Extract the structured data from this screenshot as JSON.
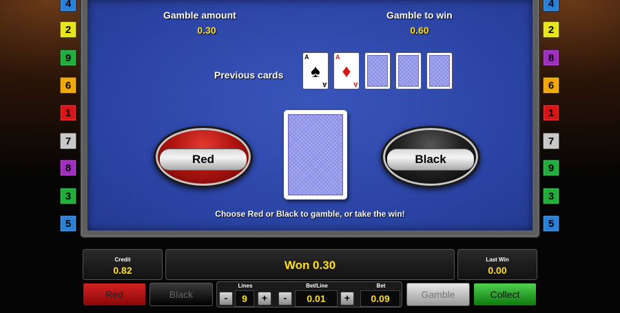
{
  "left_badges": [
    {
      "label": "4",
      "color": "#2a7fd6",
      "text_color": "#000"
    },
    {
      "label": "2",
      "color": "#e6e61a",
      "text_color": "#000"
    },
    {
      "label": "9",
      "color": "#1fae3a",
      "text_color": "#000"
    },
    {
      "label": "6",
      "color": "#f0a800",
      "text_color": "#000"
    },
    {
      "label": "1",
      "color": "#d81414",
      "text_color": "#000"
    },
    {
      "label": "7",
      "color": "#c8c8c8",
      "text_color": "#000"
    },
    {
      "label": "8",
      "color": "#a02cc0",
      "text_color": "#000"
    },
    {
      "label": "3",
      "color": "#1fae3a",
      "text_color": "#000"
    },
    {
      "label": "5",
      "color": "#2a7fd6",
      "text_color": "#000"
    }
  ],
  "right_badges": [
    {
      "label": "4",
      "color": "#2a7fd6",
      "text_color": "#000"
    },
    {
      "label": "2",
      "color": "#e6e61a",
      "text_color": "#000"
    },
    {
      "label": "8",
      "color": "#a02cc0",
      "text_color": "#000"
    },
    {
      "label": "6",
      "color": "#f0a800",
      "text_color": "#000"
    },
    {
      "label": "1",
      "color": "#d81414",
      "text_color": "#000"
    },
    {
      "label": "7",
      "color": "#c8c8c8",
      "text_color": "#000"
    },
    {
      "label": "9",
      "color": "#1fae3a",
      "text_color": "#000"
    },
    {
      "label": "3",
      "color": "#1fae3a",
      "text_color": "#000"
    },
    {
      "label": "5",
      "color": "#2a7fd6",
      "text_color": "#000"
    }
  ],
  "gamble": {
    "amount_label": "Gamble amount",
    "amount_value": "0.30",
    "to_win_label": "Gamble to win",
    "to_win_value": "0.60",
    "previous_cards_label": "Previous cards",
    "previous_cards": [
      {
        "rank": "A",
        "suit": "♠",
        "color": "#000"
      },
      {
        "rank": "A",
        "suit": "♦",
        "color": "#d81414"
      },
      {
        "back": true
      },
      {
        "back": true
      },
      {
        "back": true
      }
    ],
    "red_label": "Red",
    "black_label": "Black",
    "message": "Choose Red or Black to gamble, or take the win!"
  },
  "status": {
    "credit_label": "Credit",
    "credit_value": "0.82",
    "won_text": "Won 0.30",
    "last_win_label": "Last Win",
    "last_win_value": "0.00"
  },
  "controls": {
    "red_label": "Red",
    "black_label": "Black",
    "lines_label": "Lines",
    "lines_value": "9",
    "betline_label": "Bet/Line",
    "betline_value": "0.01",
    "bet_label": "Bet",
    "bet_value": "0.09",
    "minus": "-",
    "plus": "+",
    "gamble_label": "Gamble",
    "collect_label": "Collect"
  }
}
